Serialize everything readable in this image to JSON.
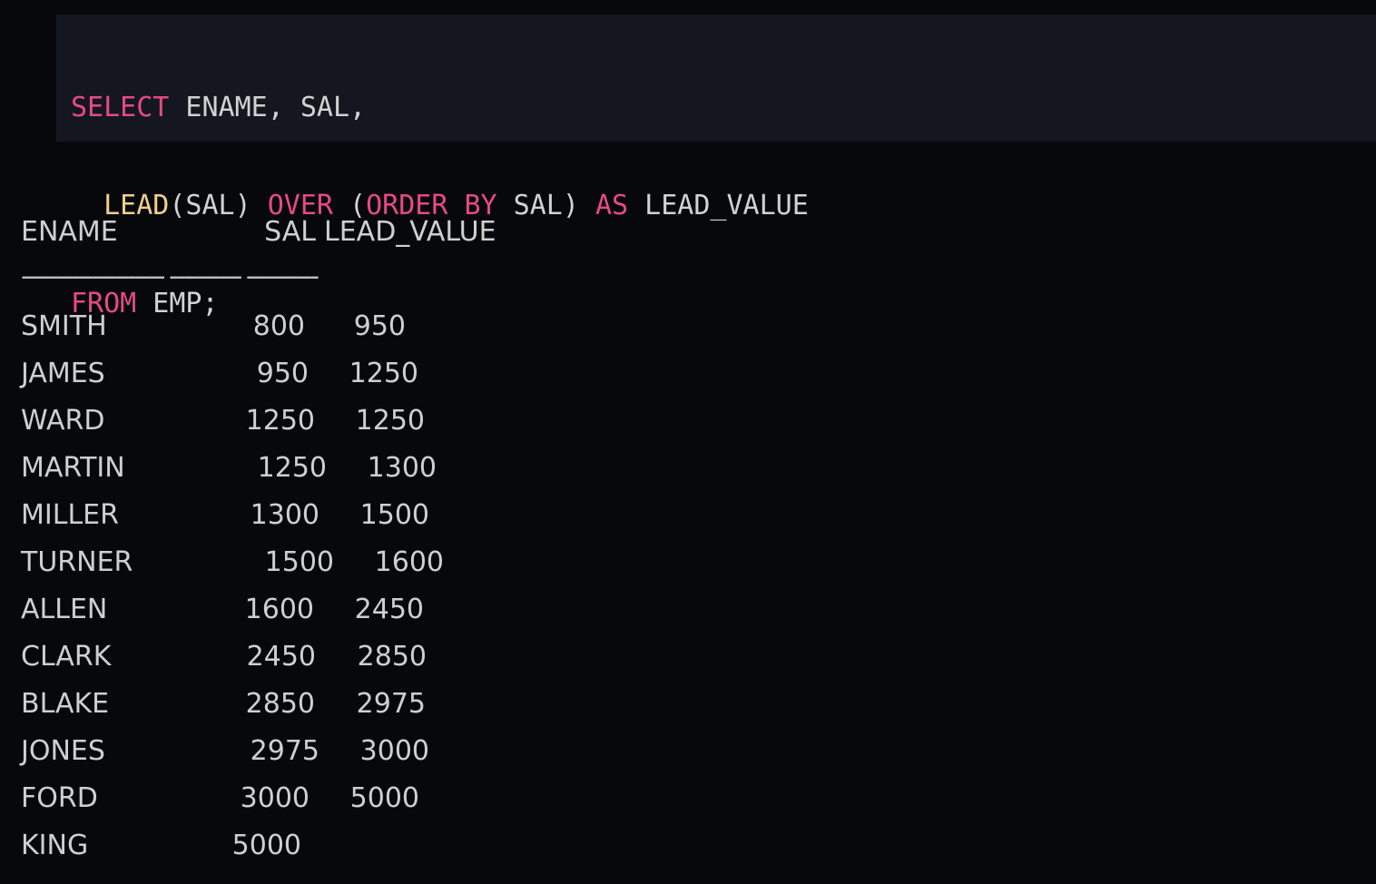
{
  "code": {
    "line1": [
      {
        "t": "SELECT",
        "c": "kw"
      },
      {
        "t": " ENAME, SAL,",
        "c": "plain"
      }
    ],
    "line2": [
      {
        "t": "  ",
        "c": "plain"
      },
      {
        "t": "LEAD",
        "c": "fn"
      },
      {
        "t": "(SAL) ",
        "c": "plain"
      },
      {
        "t": "OVER",
        "c": "kw"
      },
      {
        "t": " (",
        "c": "plain"
      },
      {
        "t": "ORDER BY",
        "c": "kw"
      },
      {
        "t": " SAL) ",
        "c": "plain"
      },
      {
        "t": "AS",
        "c": "kw"
      },
      {
        "t": " LEAD_VALUE",
        "c": "plain"
      }
    ],
    "line3": [
      {
        "t": "FROM",
        "c": "kw"
      },
      {
        "t": " EMP;",
        "c": "plain"
      }
    ]
  },
  "result": {
    "headers": {
      "ename": "ENAME",
      "sal": "SAL",
      "lead": "LEAD_VALUE"
    },
    "divider": "-------------------- ---------- ----------",
    "rows": [
      {
        "ename": "SMITH",
        "sal": "800",
        "lead": "950"
      },
      {
        "ename": "JAMES",
        "sal": "950",
        "lead": "1250"
      },
      {
        "ename": "WARD",
        "sal": "1250",
        "lead": "1250"
      },
      {
        "ename": "MARTIN",
        "sal": "1250",
        "lead": "1300"
      },
      {
        "ename": "MILLER",
        "sal": "1300",
        "lead": "1500"
      },
      {
        "ename": "TURNER",
        "sal": "1500",
        "lead": "1600"
      },
      {
        "ename": "ALLEN",
        "sal": "1600",
        "lead": "2450"
      },
      {
        "ename": "CLARK",
        "sal": "2450",
        "lead": "2850"
      },
      {
        "ename": "BLAKE",
        "sal": "2850",
        "lead": "2975"
      },
      {
        "ename": "JONES",
        "sal": "2975",
        "lead": "3000"
      },
      {
        "ename": "FORD",
        "sal": "3000",
        "lead": "5000"
      },
      {
        "ename": "KING",
        "sal": "5000",
        "lead": ""
      }
    ]
  }
}
